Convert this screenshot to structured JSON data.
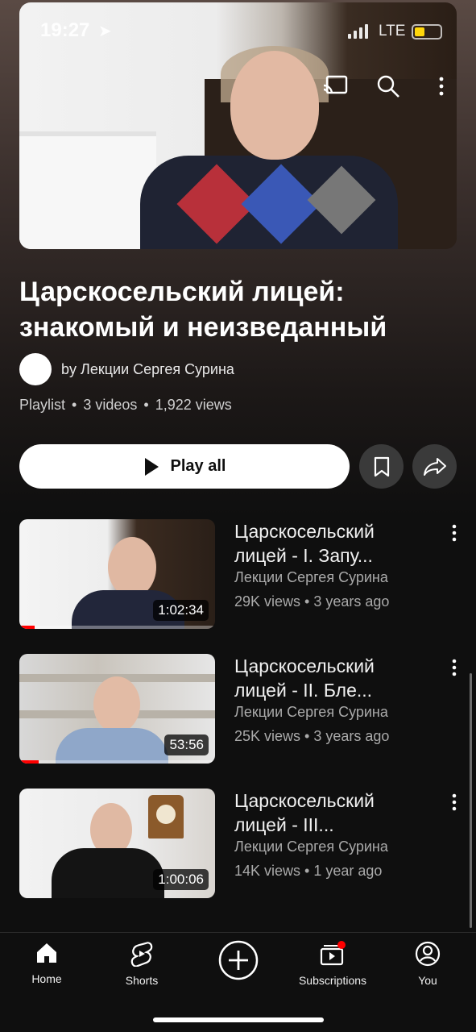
{
  "status_bar": {
    "time": "19:27",
    "network": "LTE"
  },
  "playlist": {
    "title": "Царскосельский лицей: знакомый и неизведанный",
    "channel": "by Лекции Сергея Сурина",
    "type": "Playlist",
    "video_count": "3 videos",
    "views": "1,922 views",
    "play_all_label": "Play all"
  },
  "videos": [
    {
      "title": "Царскосельский лицей - I. Запу...",
      "channel": "Лекции Сергея Сурина",
      "views": "29K views",
      "age": "3 years ago",
      "duration": "1:02:34",
      "watched_fraction": 0.08
    },
    {
      "title": "Царскосельский лицей - II. Бле...",
      "channel": "Лекции Сергея Сурина",
      "views": "25K views",
      "age": "3 years ago",
      "duration": "53:56",
      "watched_fraction": 0.1
    },
    {
      "title": "Царскосельский лицей - III...",
      "channel": "Лекции Сергея Сурина",
      "views": "14K views",
      "age": "1 year ago",
      "duration": "1:00:06",
      "watched_fraction": 0
    }
  ],
  "nav": {
    "home": "Home",
    "shorts": "Shorts",
    "subscriptions": "Subscriptions",
    "you": "You"
  },
  "colors": {
    "accent": "#ff0000",
    "notification": "#ff0000",
    "battery": "#ffd60a"
  }
}
